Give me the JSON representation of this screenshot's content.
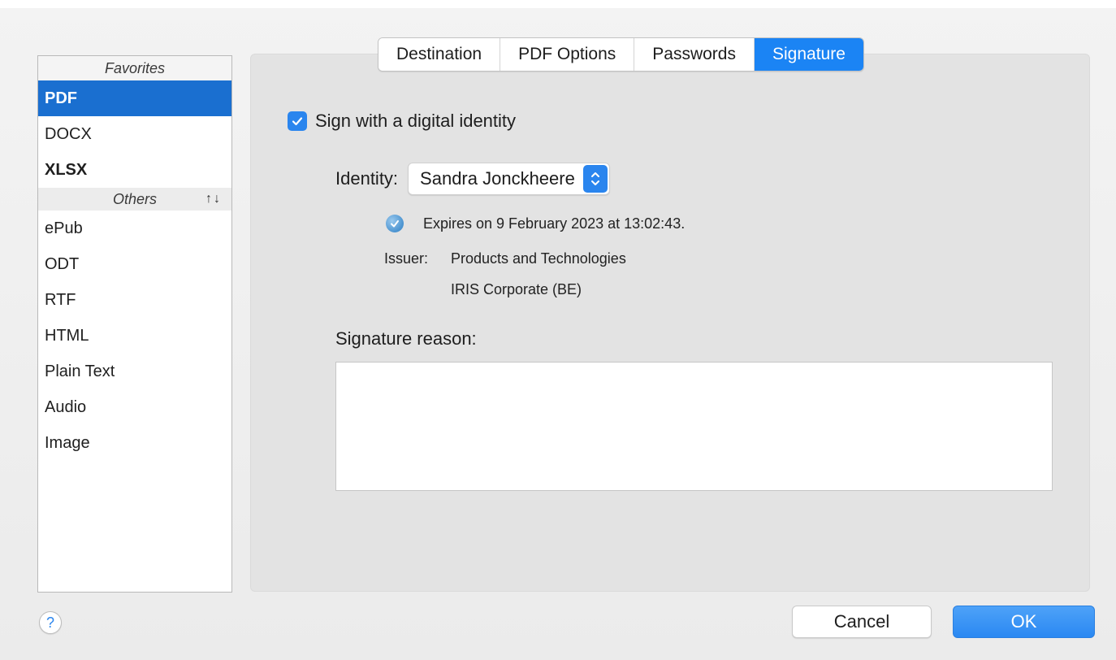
{
  "sidebar": {
    "favorites_header": "Favorites",
    "others_header": "Others",
    "sort_arrows": "↑↓",
    "favorites": [
      {
        "label": "PDF"
      },
      {
        "label": "DOCX"
      },
      {
        "label": "XLSX"
      }
    ],
    "others": [
      {
        "label": "ePub"
      },
      {
        "label": "ODT"
      },
      {
        "label": "RTF"
      },
      {
        "label": "HTML"
      },
      {
        "label": "Plain Text"
      },
      {
        "label": "Audio"
      },
      {
        "label": "Image"
      }
    ],
    "selected": "PDF"
  },
  "tabs": [
    {
      "label": "Destination"
    },
    {
      "label": "PDF Options"
    },
    {
      "label": "Passwords"
    },
    {
      "label": "Signature"
    }
  ],
  "active_tab": "Signature",
  "signature": {
    "sign_checkbox_label": "Sign with a digital identity",
    "sign_checked": true,
    "identity_label": "Identity:",
    "identity_value": "Sandra Jonckheere",
    "expires_text": "Expires on 9 February 2023 at 13:02:43.",
    "issuer_label": "Issuer:",
    "issuer_line1": "Products and Technologies",
    "issuer_line2": "IRIS Corporate (BE)",
    "reason_label": "Signature reason:",
    "reason_value": ""
  },
  "footer": {
    "help_label": "?",
    "cancel_label": "Cancel",
    "ok_label": "OK"
  },
  "colors": {
    "accent": "#1b84f4",
    "selection": "#1a6fd0"
  }
}
